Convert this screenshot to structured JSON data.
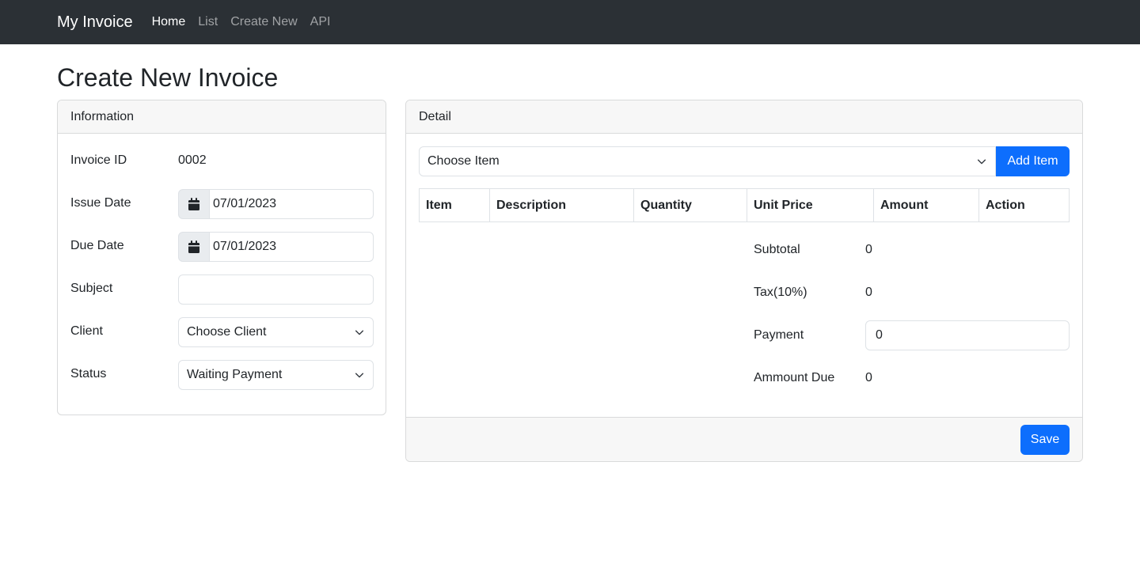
{
  "nav": {
    "brand": "My Invoice",
    "links": [
      "Home",
      "List",
      "Create New",
      "API"
    ]
  },
  "page": {
    "title": "Create New Invoice"
  },
  "info": {
    "header": "Information",
    "invoice_id_label": "Invoice ID",
    "invoice_id_value": "0002",
    "issue_date_label": "Issue Date",
    "issue_date_value": "07/01/2023",
    "due_date_label": "Due Date",
    "due_date_value": "07/01/2023",
    "subject_label": "Subject",
    "subject_value": "",
    "client_label": "Client",
    "client_value": "Choose Client",
    "status_label": "Status",
    "status_value": "Waiting Payment"
  },
  "detail": {
    "header": "Detail",
    "item_select": "Choose Item",
    "add_item_label": "Add Item",
    "columns": [
      "Item",
      "Description",
      "Quantity",
      "Unit Price",
      "Amount",
      "Action"
    ],
    "subtotal_label": "Subtotal",
    "subtotal_value": "0",
    "tax_label": "Tax(10%)",
    "tax_value": "0",
    "payment_label": "Payment",
    "payment_value": "0",
    "amount_due_label": "Ammount Due",
    "amount_due_value": "0",
    "save_label": "Save"
  },
  "colors": {
    "navbar": "#2b3035",
    "primary": "#0d6efd",
    "card_header": "#f7f7f7"
  }
}
